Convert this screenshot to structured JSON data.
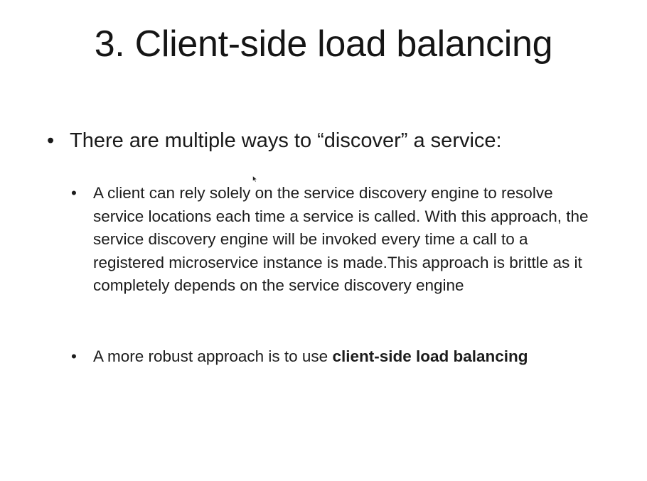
{
  "slide": {
    "title": "3. Client-side load balancing",
    "bullet_marker": "•",
    "main_bullet": "There are multiple ways to “discover” a service:",
    "sub_bullets": [
      {
        "text": "A client can rely solely on the service discovery engine to resolve service locations each time a service is called. With this approach, the service discovery engine will be invoked every time a call to a registered microservice instance is made.This approach is brittle as it completely depends on the service discovery engine"
      },
      {
        "text_prefix": "A more robust approach is to use ",
        "text_bold": "client-side load balancing"
      }
    ]
  }
}
